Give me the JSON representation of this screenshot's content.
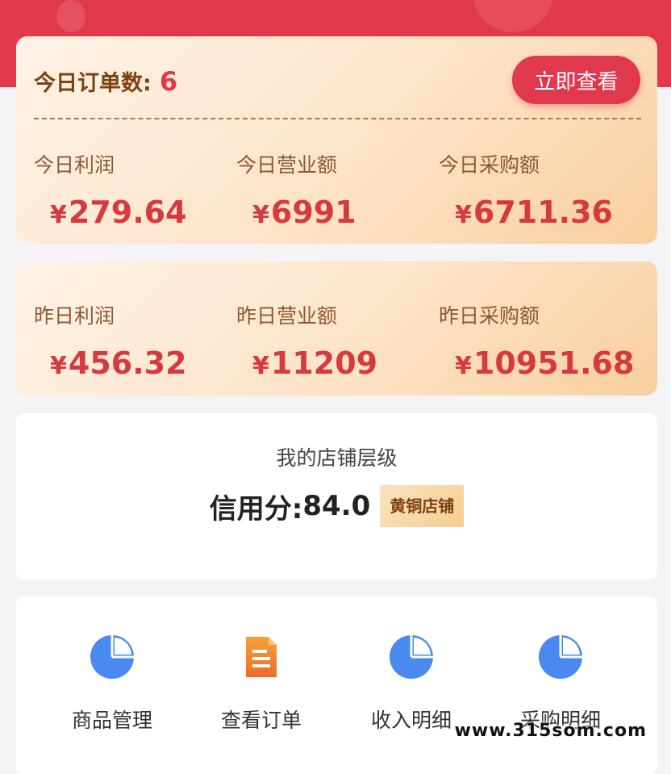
{
  "today": {
    "orders_label": "今日订单数:",
    "orders_value": "6",
    "view_button": "立即查看",
    "stats": [
      {
        "label": "今日利润",
        "currency": "¥",
        "value": "279.64"
      },
      {
        "label": "今日营业额",
        "currency": "¥",
        "value": "6991"
      },
      {
        "label": "今日采购额",
        "currency": "¥",
        "value": "6711.36"
      }
    ]
  },
  "yesterday": {
    "stats": [
      {
        "label": "昨日利润",
        "currency": "¥",
        "value": "456.32"
      },
      {
        "label": "昨日营业额",
        "currency": "¥",
        "value": "11209"
      },
      {
        "label": "昨日采购额",
        "currency": "¥",
        "value": "10951.68"
      }
    ]
  },
  "shop_level": {
    "title": "我的店铺层级",
    "credit_label": "信用分:",
    "credit_value": "84.0",
    "badge": "黄铜店铺"
  },
  "menu": [
    {
      "label": "商品管理",
      "icon": "pie-chart-icon"
    },
    {
      "label": "查看订单",
      "icon": "document-icon"
    },
    {
      "label": "收入明细",
      "icon": "pie-chart-icon"
    },
    {
      "label": "采购明细",
      "icon": "pie-chart-icon"
    }
  ],
  "watermark": "www.315som.com",
  "colors": {
    "header_red": "#e2394a",
    "value_red": "#d63a3f",
    "label_brown": "#8a5a33",
    "icon_blue": "#4a8af0",
    "icon_orange": "#f07a2e"
  }
}
